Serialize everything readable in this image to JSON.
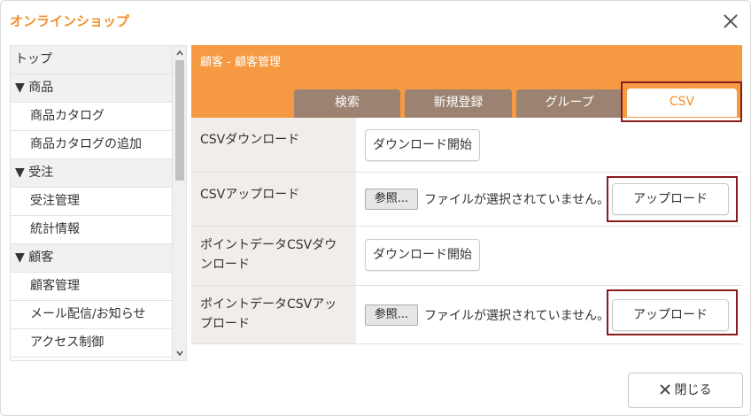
{
  "window": {
    "title": "オンラインショップ",
    "footer_close_label": "閉じる"
  },
  "sidebar": {
    "items": [
      {
        "label": "トップ",
        "kind": "top"
      },
      {
        "label": "▼ 商品",
        "kind": "cat"
      },
      {
        "label": "商品カタログ",
        "kind": "sub"
      },
      {
        "label": "商品カタログの追加",
        "kind": "sub"
      },
      {
        "label": "▼ 受注",
        "kind": "cat"
      },
      {
        "label": "受注管理",
        "kind": "sub"
      },
      {
        "label": "統計情報",
        "kind": "sub"
      },
      {
        "label": "▼ 顧客",
        "kind": "cat"
      },
      {
        "label": "顧客管理",
        "kind": "sub"
      },
      {
        "label": "メール配信/お知らせ",
        "kind": "sub"
      },
      {
        "label": "アクセス制御",
        "kind": "sub"
      }
    ]
  },
  "main": {
    "header": "顧客 - 顧客管理",
    "tabs": [
      {
        "label": "検索"
      },
      {
        "label": "新規登録"
      },
      {
        "label": "グループ"
      },
      {
        "label": "CSV",
        "active": true
      }
    ],
    "rows": [
      {
        "label": "CSVダウンロード",
        "button": "ダウンロード開始"
      },
      {
        "label": "CSVアップロード",
        "browse": "参照...",
        "file_status": "ファイルが選択されていません。",
        "button": "アップロード"
      },
      {
        "label": "ポイントデータCSVダウンロード",
        "button": "ダウンロード開始"
      },
      {
        "label": "ポイントデータCSVアップロード",
        "browse": "参照...",
        "file_status": "ファイルが選択されていません。",
        "button": "アップロード"
      }
    ]
  },
  "colors": {
    "accent": "#f59a42",
    "tab_inactive": "#9c8270",
    "highlight": "#8b1a1a",
    "label_bg": "#f2ede8"
  }
}
